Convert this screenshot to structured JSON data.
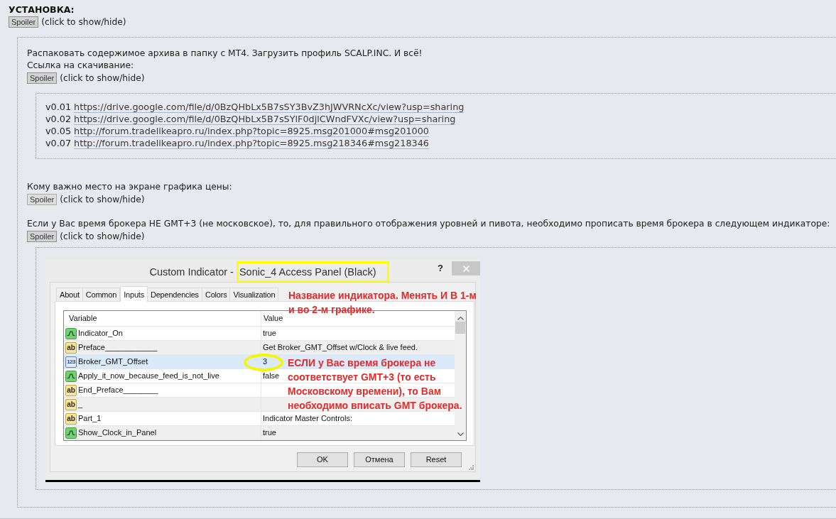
{
  "heading": "УСТАНОВКА:",
  "spoiler": {
    "label": "Spoiler",
    "hint": "(click to show/hide)",
    "expanded": true,
    "body": {
      "kind": "blocks",
      "blocks": [
        {
          "kind": "text",
          "text": "Распаковать содержимое архива в папку с MT4. Загрузить профиль SCALP.INC. И всё!"
        },
        {
          "kind": "text",
          "text": "Ссылка на скачивание:"
        },
        {
          "kind": "spoiler",
          "label": "Spoiler",
          "hint": "(click to show/hide)",
          "expanded": true,
          "body": {
            "kind": "links",
            "links": [
              {
                "version": "v0.01",
                "url": "https://drive.google.com/file/d/0BzQHbLx5B7sSY3BvZ3hJWVRNcXc/view?usp=sharing"
              },
              {
                "version": "v0.02",
                "url": "https://drive.google.com/file/d/0BzQHbLx5B7sSYlF0djlCWndFVXc/view?usp=sharing"
              },
              {
                "version": "v0.05",
                "url": "http://forum.tradelikeapro.ru/index.php?topic=8925.msg201000#msg201000"
              },
              {
                "version": "v0.07",
                "url": "http://forum.tradelikeapro.ru/index.php?topic=8925.msg218346#msg218346"
              }
            ]
          }
        },
        {
          "kind": "text",
          "text": "Кому важно место на экране графика цены:"
        },
        {
          "kind": "spoiler",
          "label": "Spoiler",
          "hint": "(click to show/hide)",
          "expanded": false
        },
        {
          "kind": "text",
          "text": "Если у Вас время брокера НЕ GMT+3 (не московское), то, для правильного отображения уровней и пивота, необходимо прописать время брокера в следующем индикаторе:"
        },
        {
          "kind": "spoiler",
          "label": "Spoiler",
          "hint": "(click to show/hide)",
          "expanded": true,
          "body": {
            "kind": "screenshot",
            "dialog": {
              "title_parts": [
                {
                  "text": "Custom Indicator -",
                  "highlighted": false
                },
                {
                  "text": "Sonic_4 Access Panel (Black)",
                  "highlighted": true
                }
              ],
              "help": "?",
              "tabs": [
                {
                  "label": "About",
                  "selected": false
                },
                {
                  "label": "Common",
                  "selected": false
                },
                {
                  "label": "Inputs",
                  "selected": true
                },
                {
                  "label": "Dependencies",
                  "selected": false
                },
                {
                  "label": "Colors",
                  "selected": false
                },
                {
                  "label": "Visualization",
                  "selected": false
                }
              ],
              "columns": [
                "Variable",
                "Value"
              ],
              "rows": [
                {
                  "kind": "bool",
                  "name": "Indicator_On",
                  "value": "true",
                  "selected": false,
                  "shaded": false,
                  "circled": false
                },
                {
                  "kind": "string",
                  "badge": "ab",
                  "name": "Preface____________",
                  "value": "Get Broker_GMT_Offset w/Clock & live feed.",
                  "selected": false,
                  "shaded": true,
                  "circled": false
                },
                {
                  "kind": "int",
                  "badge": "123",
                  "name": "Broker_GMT_Offset",
                  "value": "3",
                  "selected": true,
                  "shaded": false,
                  "circled": true
                },
                {
                  "kind": "bool",
                  "name": "Apply_it_now_because_feed_is_not_live",
                  "value": "false",
                  "selected": false,
                  "shaded": false,
                  "circled": false
                },
                {
                  "kind": "string",
                  "badge": "ab",
                  "name": "End_Preface________",
                  "selected": false,
                  "shaded": false,
                  "circled": false
                },
                {
                  "kind": "string",
                  "badge": "ab",
                  "name": "_",
                  "selected": false,
                  "shaded": true,
                  "circled": false
                },
                {
                  "kind": "string",
                  "badge": "ab",
                  "name": "Part_1",
                  "value": "Indicator Master Controls:",
                  "selected": false,
                  "shaded": false,
                  "circled": false
                },
                {
                  "kind": "bool",
                  "name": "Show_Clock_in_Panel",
                  "value": "true",
                  "selected": false,
                  "shaded": true,
                  "circled": false
                }
              ],
              "buttons": [
                "OK",
                "Отмена",
                "Reset"
              ]
            },
            "notes": [
              {
                "lines": [
                  "Название индикатора. Менять И В 1-м",
                  "и во 2-м графике."
                ]
              },
              {
                "lines": [
                  "ЕСЛИ у Вас время брокера не",
                  "соответствует GMT+3 (то есть",
                  "Московскому времени), то Вам",
                  "необходимо вписать GMT брокера."
                ]
              }
            ]
          }
        }
      ]
    }
  }
}
